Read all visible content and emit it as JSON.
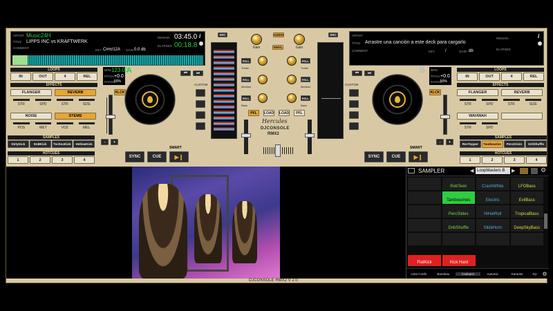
{
  "deckA": {
    "artist_lbl": "ARTIST",
    "artist": "Music24H",
    "title_lbl": "TITLE",
    "title": "LIPPS INC vs KRAFTWERK",
    "comment_lbl": "COMMENT",
    "remain_lbl": "REMAIN",
    "remain": "03:45.0",
    "elapsed_lbl": "ELAPSED",
    "elapsed": "00:18.8",
    "key_lbl": "KEY",
    "key": "C#m/12A",
    "gain_lbl": "GAIN",
    "gain": "0.0 db",
    "letter": "A",
    "bpm_lbl": "BPM",
    "bpm": "123.00",
    "pitch_lbl": "PITCH",
    "pitch": "+0.0",
    "range_lbl": "RANGE",
    "range": "50%",
    "loops": [
      "IN",
      "OUT",
      "4",
      "REL"
    ],
    "effects": [
      "FLANGER",
      "REVERB",
      "NOISE",
      "STEMS"
    ],
    "fx_knobs": [
      "STR",
      "SPD",
      "STR",
      "SIZE"
    ],
    "stems_knobs": [
      "POS",
      "WET",
      "VOZ",
      "MEL"
    ],
    "samples": [
      "DirtyKick",
      "DnBKick",
      "TechnoKick",
      "HellowKick"
    ],
    "hotcues": [
      "1",
      "2",
      "3",
      "4"
    ],
    "klck": "KLCK",
    "custom": "CUSTOM",
    "sync": "SYNC",
    "cue": "CUE",
    "smart": "SMART",
    "minus": "-",
    "plus": "+"
  },
  "deckB": {
    "artist_lbl": "ARTIST",
    "title_lbl": "TITLE",
    "title": "Arrastre una canción a este deck para cargarlo",
    "comment_lbl": "COMMENT",
    "key_lbl": "KEY",
    "key": "/",
    "gain_lbl": "GAIN",
    "gain": "db",
    "remain_lbl": "REMAIN",
    "elapsed_lbl": "ELAPSED",
    "letter": "B",
    "bpm_lbl": "BPM",
    "pitch_lbl": "PITCH",
    "pitch": "+0.0",
    "range_lbl": "RANGE",
    "range": "50%",
    "loops": [
      "IN",
      "OUT",
      "4",
      "REL"
    ],
    "effects": [
      "FLANGER",
      "REVERB",
      "WAHWAH",
      ""
    ],
    "fx_knobs": [
      "STR",
      "SPD",
      "STR",
      "SIZE"
    ],
    "wah_knobs": [
      "STR",
      "SPD"
    ],
    "samples": [
      "RevTopper",
      "Tambourine",
      "PercDrivin",
      "DrilShuffle"
    ],
    "hotcues": [
      "1",
      "2",
      "3",
      "4"
    ],
    "klck": "KLCK",
    "custom": "CUSTOM",
    "sync": "SYNC",
    "cue": "CUE",
    "smart": "SMART",
    "minus": "-",
    "plus": "+"
  },
  "sections": {
    "loops": "LOOPS",
    "effects": "EFFECTS",
    "samples": "SAMPLES",
    "hotcues": "HOTCUES"
  },
  "mixer": {
    "src": "SRC",
    "audio": "AUDIO",
    "vinyl": "VINYL",
    "gain": "Gain",
    "kill": "KILL",
    "treble": "Treble",
    "medium": "Medium",
    "bass": "Bass",
    "pfl": "PFL",
    "load": "LOAD",
    "brand": "Hercules",
    "logo1": "DJCONSOLE",
    "logo2": "RMX2"
  },
  "sampler": {
    "title": "SAMPLER",
    "bank": "LoopMasters B",
    "pads": [
      {
        "label": "",
        "color": "r"
      },
      {
        "label": "RebTeen",
        "color": "g"
      },
      {
        "label": "CrashWhite",
        "color": "b"
      },
      {
        "label": "LFOBass",
        "color": "y"
      },
      {
        "label": "",
        "color": "r"
      },
      {
        "label": "Tambourines",
        "color": "g"
      },
      {
        "label": "Electric",
        "color": "b"
      },
      {
        "label": "EvilBass",
        "color": "y"
      },
      {
        "label": "",
        "color": "r"
      },
      {
        "label": "PercSlides",
        "color": "g"
      },
      {
        "label": "HiHatRoll",
        "color": "b"
      },
      {
        "label": "TropicalBass",
        "color": "y"
      },
      {
        "label": "",
        "color": "r"
      },
      {
        "label": "DnbShuffle",
        "color": "g"
      },
      {
        "label": "SlideHorn",
        "color": "b"
      },
      {
        "label": "DeepSkyBass",
        "color": "y"
      }
    ],
    "big1": "FlatKick",
    "big2": "Kick Hard",
    "tabs": [
      "Lista Confs",
      "Bandeau",
      "Cadepes",
      "Automix",
      "Karaoke"
    ],
    "tab_dj": "Dj+"
  },
  "footer": "DJCONSOLE RMX2 V 2.0",
  "colors": {
    "gold": "#e8a531",
    "panel": "#d8c9a4",
    "green": "#2ecc40"
  }
}
